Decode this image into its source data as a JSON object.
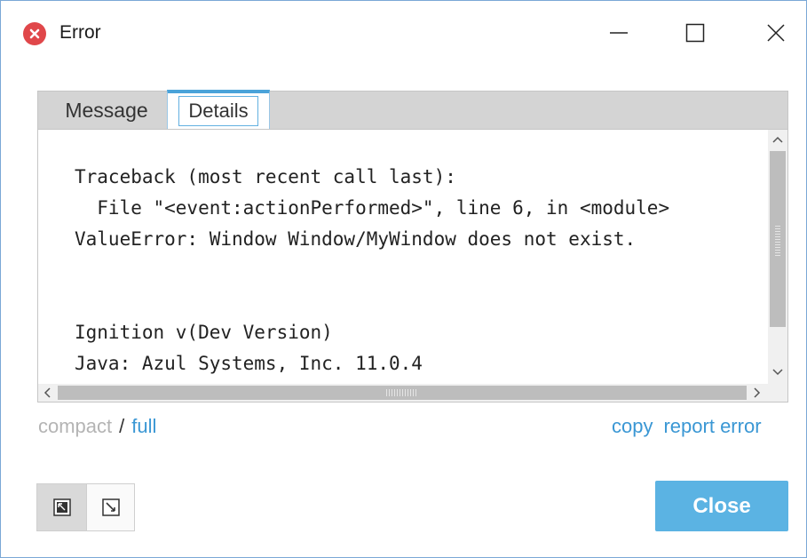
{
  "window": {
    "title": "Error",
    "controls": {
      "minimize": "—",
      "maximize": "☐",
      "close": "✕"
    }
  },
  "tabs": [
    {
      "label": "Message",
      "active": false
    },
    {
      "label": "Details",
      "active": true
    }
  ],
  "details": {
    "lines": [
      "Traceback (most recent call last):",
      "  File \"<event:actionPerformed>\", line 6, in <module>",
      "ValueError: Window Window/MyWindow does not exist.",
      "",
      "",
      "Ignition v(Dev Version)",
      "Java: Azul Systems, Inc. 11.0.4"
    ]
  },
  "view_mode": {
    "compact": "compact",
    "separator": "/",
    "full": "full",
    "selected": "full"
  },
  "actions": {
    "copy": "copy",
    "report_error": "report error",
    "close": "Close"
  },
  "icons": {
    "title": "error-icon",
    "toggle_left": "collapse-icon",
    "toggle_right": "expand-icon"
  },
  "colors": {
    "accent": "#5bb3e3",
    "link": "#3a97d4",
    "error": "#e0474a"
  }
}
